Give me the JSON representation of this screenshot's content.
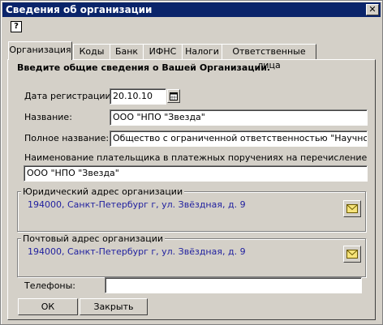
{
  "window": {
    "title": "Сведения об организации",
    "close_symbol": "✕",
    "help_symbol": "?"
  },
  "tabs": [
    {
      "label": "Организация"
    },
    {
      "label": "Коды"
    },
    {
      "label": "Банк"
    },
    {
      "label": "ИФНС"
    },
    {
      "label": "Налоги"
    },
    {
      "label": "Ответственные лица"
    }
  ],
  "panel": {
    "heading": "Введите общие сведения о Вашей Организации.",
    "registration_date": {
      "label": "Дата регистрации:",
      "value": "20.10.10"
    },
    "name": {
      "label": "Название:",
      "value": "ООО \"НПО \"Звезда\""
    },
    "full_name": {
      "label": "Полное название:",
      "value": "Общество с ограниченной ответственностью \"Научно-производ"
    },
    "payer_name": {
      "label": "Наименование плательщика в платежных поручениях на перечисление налогов:",
      "value": "ООО \"НПО \"Звезда\""
    },
    "legal_address": {
      "legend": "Юридический адрес организации",
      "value": "194000, Санкт-Петербург г, ул. Звёздная, д. 9"
    },
    "postal_address": {
      "legend": "Почтовый адрес организации",
      "value": "194000, Санкт-Петербург г, ул. Звёздная, д. 9"
    },
    "phones": {
      "label": "Телефоны:",
      "value": ""
    }
  },
  "buttons": {
    "ok": "ОК",
    "close": "Закрыть"
  }
}
